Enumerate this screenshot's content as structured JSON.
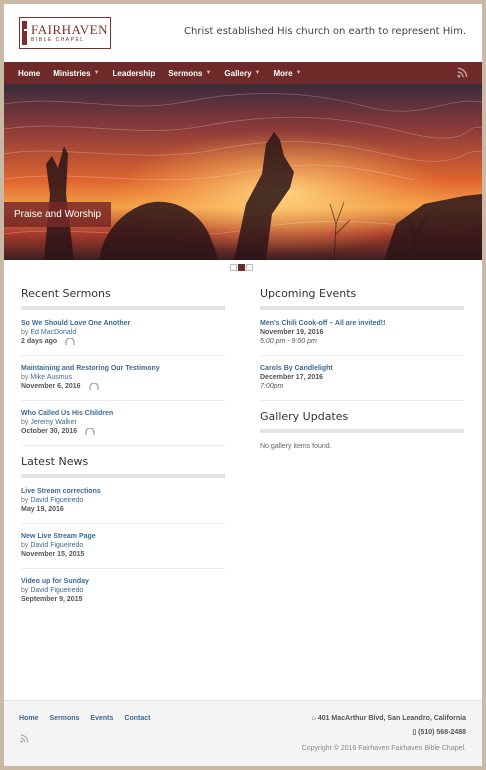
{
  "header": {
    "logo_name": "FAIRHAVEN",
    "logo_sub": "BIBLE CHAPEL",
    "tagline": "Christ established His church on earth to represent Him."
  },
  "nav": {
    "items": [
      "Home",
      "Ministries",
      "Leadership",
      "Sermons",
      "Gallery",
      "More"
    ]
  },
  "hero": {
    "caption": "Praise and Worship",
    "slide_index": 2,
    "slide_count": 3
  },
  "recent_sermons": {
    "title": "Recent Sermons",
    "items": [
      {
        "title": "So We Should Love One Another",
        "by": "by",
        "author": "Ed MacDonald",
        "date": "2 days ago"
      },
      {
        "title": "Maintaining and Restoring Our Testimony",
        "by": "by",
        "author": "Mike Ausmus",
        "date": "November 6, 2016"
      },
      {
        "title": "Who Called Us His Children",
        "by": "by",
        "author": "Jeremy Walker",
        "date": "October 30, 2016"
      }
    ]
  },
  "latest_news": {
    "title": "Latest News",
    "items": [
      {
        "title": "Live Stream corrections",
        "by": "by",
        "author": "David Figueiredo",
        "date": "May 19, 2016"
      },
      {
        "title": "New Live Stream Page",
        "by": "by",
        "author": "David Figueiredo",
        "date": "November 15, 2015"
      },
      {
        "title": "Video up for Sunday",
        "by": "by",
        "author": "David Figueiredo",
        "date": "September 9, 2015"
      }
    ]
  },
  "upcoming_events": {
    "title": "Upcoming Events",
    "items": [
      {
        "title": "Men's Chili Cook-off – All are invited!!",
        "date": "November 19, 2016",
        "time": "5:00 pm - 9:00 pm"
      },
      {
        "title": "Carols By Candlelight",
        "date": "December 17, 2016",
        "time": "7:00pm"
      }
    ]
  },
  "gallery_updates": {
    "title": "Gallery Updates",
    "empty": "No gallery items found."
  },
  "footer": {
    "links": [
      "Home",
      "Sermons",
      "Events",
      "Contact"
    ],
    "address": "401 MacArthur Blvd, San Leandro, California",
    "phone": "(510) 568-2488",
    "copyright": "Copyright © 2016 Fairhaven Fairhaven Bible Chapel."
  },
  "colors": {
    "brand": "#6e2a28",
    "link": "#3a6a98"
  }
}
